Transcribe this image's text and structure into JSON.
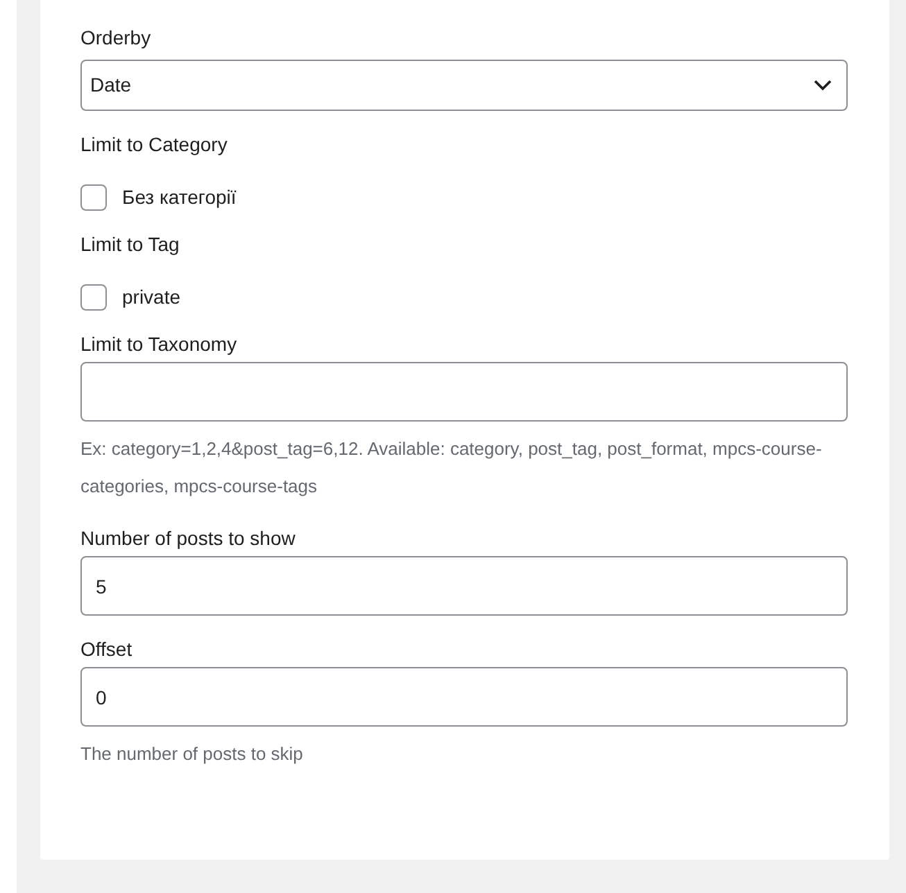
{
  "fields": [
    {
      "kind": "select",
      "label": "Orderby",
      "value": "Date"
    },
    {
      "kind": "checkboxes",
      "label": "Limit to Category",
      "options": [
        {
          "label": "Без категорії",
          "checked": false
        }
      ]
    },
    {
      "kind": "checkboxes",
      "label": "Limit to Tag",
      "options": [
        {
          "label": "private",
          "checked": false
        }
      ]
    },
    {
      "kind": "text",
      "label": "Limit to Taxonomy",
      "help": "Ex: category=1,2,4&post_tag=6,12. Available: category, post_tag, post_format, mpcs-course-categories, mpcs-course-tags"
    },
    {
      "kind": "text",
      "label": "Number of posts to show",
      "value": "5"
    },
    {
      "kind": "text",
      "label": "Offset",
      "value": "0",
      "help": "The number of posts to skip"
    }
  ]
}
